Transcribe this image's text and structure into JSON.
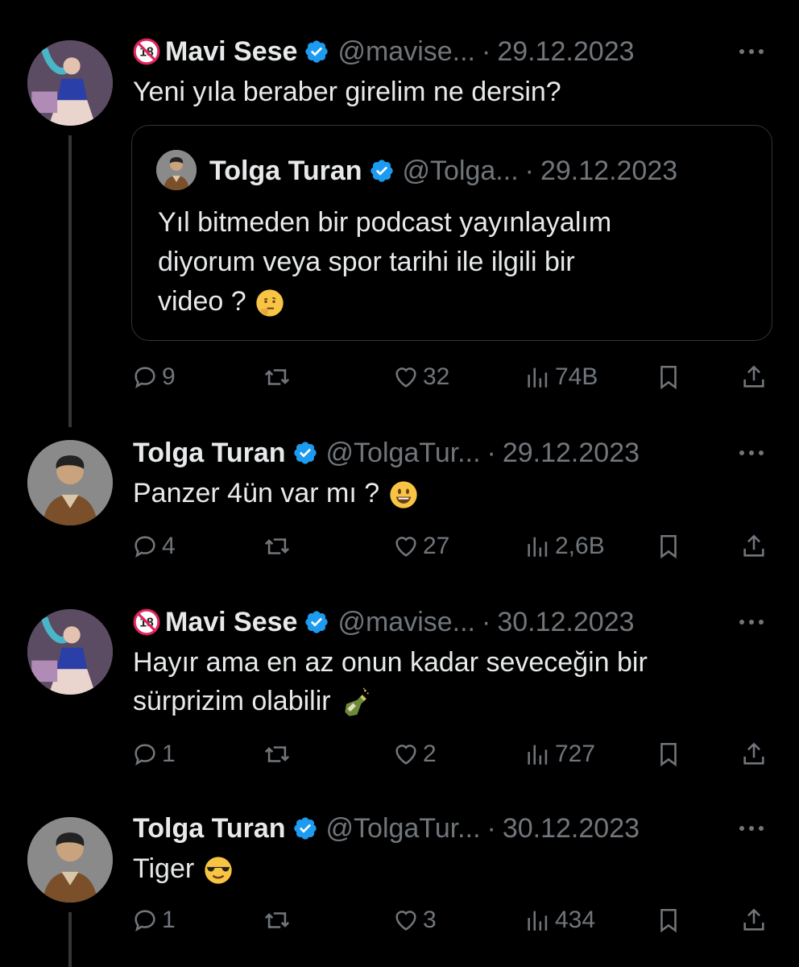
{
  "tweets": [
    {
      "name": "Mavi Sese",
      "handle": "@mavise...",
      "date": "29.12.2023",
      "text": "Yeni yıla beraber girelim ne dersin?",
      "quote": {
        "name": "Tolga Turan",
        "handle": "@Tolga...",
        "date": "29.12.2023",
        "line1": "Yıl bitmeden bir podcast yayınlayalım",
        "line2": "diyorum veya spor tarihi ile ilgili bir",
        "line3": "video ?"
      },
      "replies": "9",
      "likes": "32",
      "views": "74B"
    },
    {
      "name": "Tolga Turan",
      "handle": "@TolgaTur...",
      "date": "29.12.2023",
      "text": "Panzer 4ün var mı ?",
      "replies": "4",
      "likes": "27",
      "views": "2,6B"
    },
    {
      "name": "Mavi Sese",
      "handle": "@mavise...",
      "date": "30.12.2023",
      "line1": "Hayır ama en az onun kadar seveceğin bir",
      "line2": "sürprizim olabilir",
      "replies": "1",
      "likes": "2",
      "views": "727"
    },
    {
      "name": "Tolga Turan",
      "handle": "@TolgaTur...",
      "date": "30.12.2023",
      "text": "Tiger",
      "replies": "1",
      "likes": "3",
      "views": "434"
    }
  ],
  "icons": {
    "verified": "verified-badge-icon",
    "adult": "18-plus-icon",
    "more": "more-icon",
    "reply": "reply-icon",
    "retweet": "retweet-icon",
    "like": "heart-icon",
    "views": "views-icon",
    "bookmark": "bookmark-icon",
    "share": "share-icon",
    "thinking": "thinking-emoji-icon",
    "smile": "smile-emoji-icon",
    "champagne": "champagne-emoji-icon",
    "sunglasses": "sunglasses-emoji-icon"
  },
  "colors": {
    "background": "#000000",
    "text": "#e7e9ea",
    "muted": "#71767b",
    "verified": "#1d9bf0",
    "border": "#2f3336"
  }
}
